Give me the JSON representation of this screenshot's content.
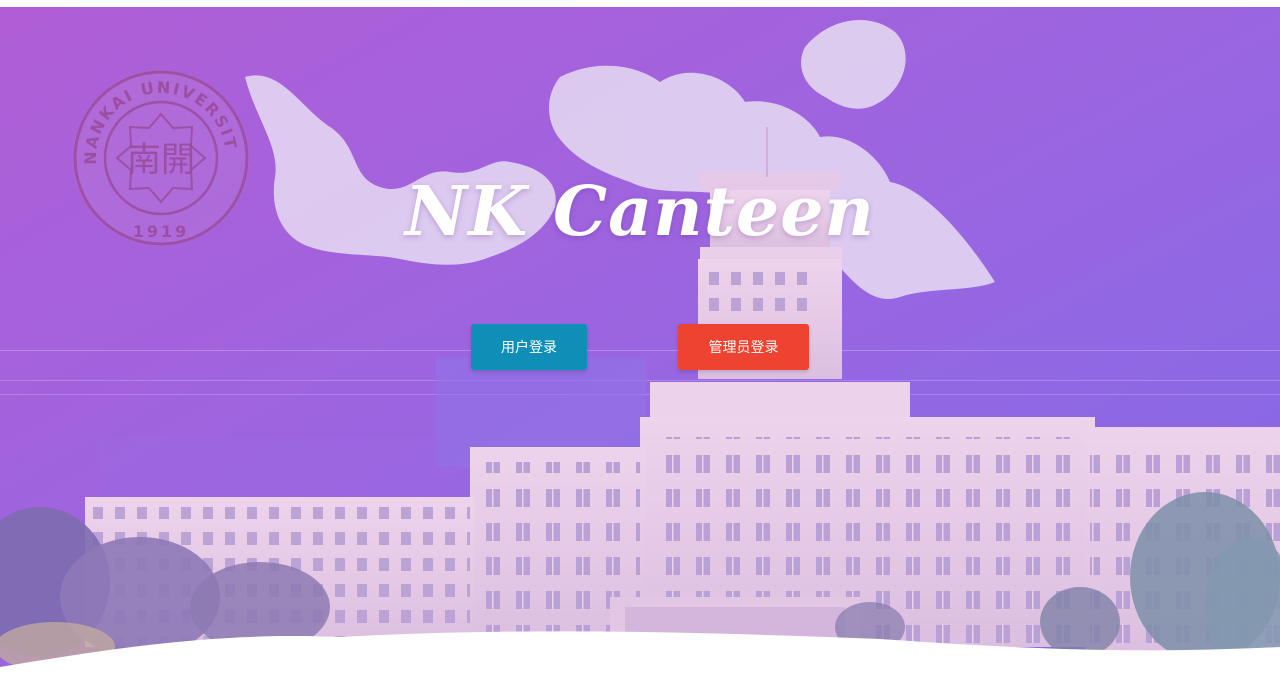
{
  "hero": {
    "title": "NK Canteen",
    "background_gradient": [
      "#b15fd8",
      "#8a6ae6"
    ],
    "building_tint": "#e8cde6"
  },
  "emblem": {
    "name": "nankai-university-seal",
    "text_top": "NANKAI UNIVERSITY",
    "text_bottom": "1919",
    "center_glyph": "南開",
    "color": "#9a3f9a"
  },
  "buttons": {
    "user_login_label": "用户登录",
    "admin_login_label": "管理员登录",
    "user_login_color": "#0f8fb8",
    "admin_login_color": "#ee4331"
  }
}
